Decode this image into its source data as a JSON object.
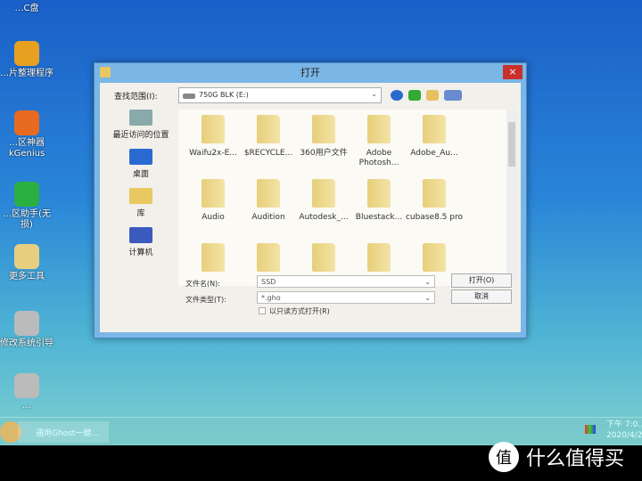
{
  "desktop": {
    "icons": [
      {
        "label": "…C盘",
        "color": "#3a6fd0"
      },
      {
        "label": "…片整理程序",
        "color": "#e8a020"
      },
      {
        "label": "…区神器 kGenius",
        "color": "#e86a20"
      },
      {
        "label": "…区助手(无损)",
        "color": "#2ab040"
      },
      {
        "label": "更多工具",
        "color": "#e8cf80"
      },
      {
        "label": "修改系统引导",
        "color": "#bbbbbb"
      },
      {
        "label": "…",
        "color": "#bbbbbb"
      }
    ]
  },
  "taskbar": {
    "item": "通用Ghost一键…",
    "clock_time": "下午 7:0…",
    "clock_date": "2020/4/2…"
  },
  "watermark": {
    "logo": "值",
    "text": "什么值得买"
  },
  "dialog": {
    "title": "打开",
    "close": "×",
    "look_in_label": "查找范围(I):",
    "look_in_value": "750G BLK (E:)",
    "places": [
      {
        "label": "最近访问的位置",
        "color": "#8aa"
      },
      {
        "label": "桌面",
        "color": "#2a6ad0"
      },
      {
        "label": "库",
        "color": "#e8c860"
      },
      {
        "label": "计算机",
        "color": "#3a5ac0"
      }
    ],
    "files": [
      "Waifu2x-E...",
      "$RECYCLE...",
      "360用户文件",
      "Adobe Photosh...",
      "Adobe_Au...",
      "Audio",
      "Audition",
      "Autodesk_...",
      "Bluestack...",
      "cubase8.5 pro",
      "",
      "",
      "",
      "",
      ""
    ],
    "filename_label": "文件名(N):",
    "filename_value": "SSD",
    "filetype_label": "文件类型(T):",
    "filetype_value": "*.gho",
    "readonly_label": "以只读方式打开(R)",
    "open_button": "打开(O)",
    "cancel_button": "取消"
  }
}
